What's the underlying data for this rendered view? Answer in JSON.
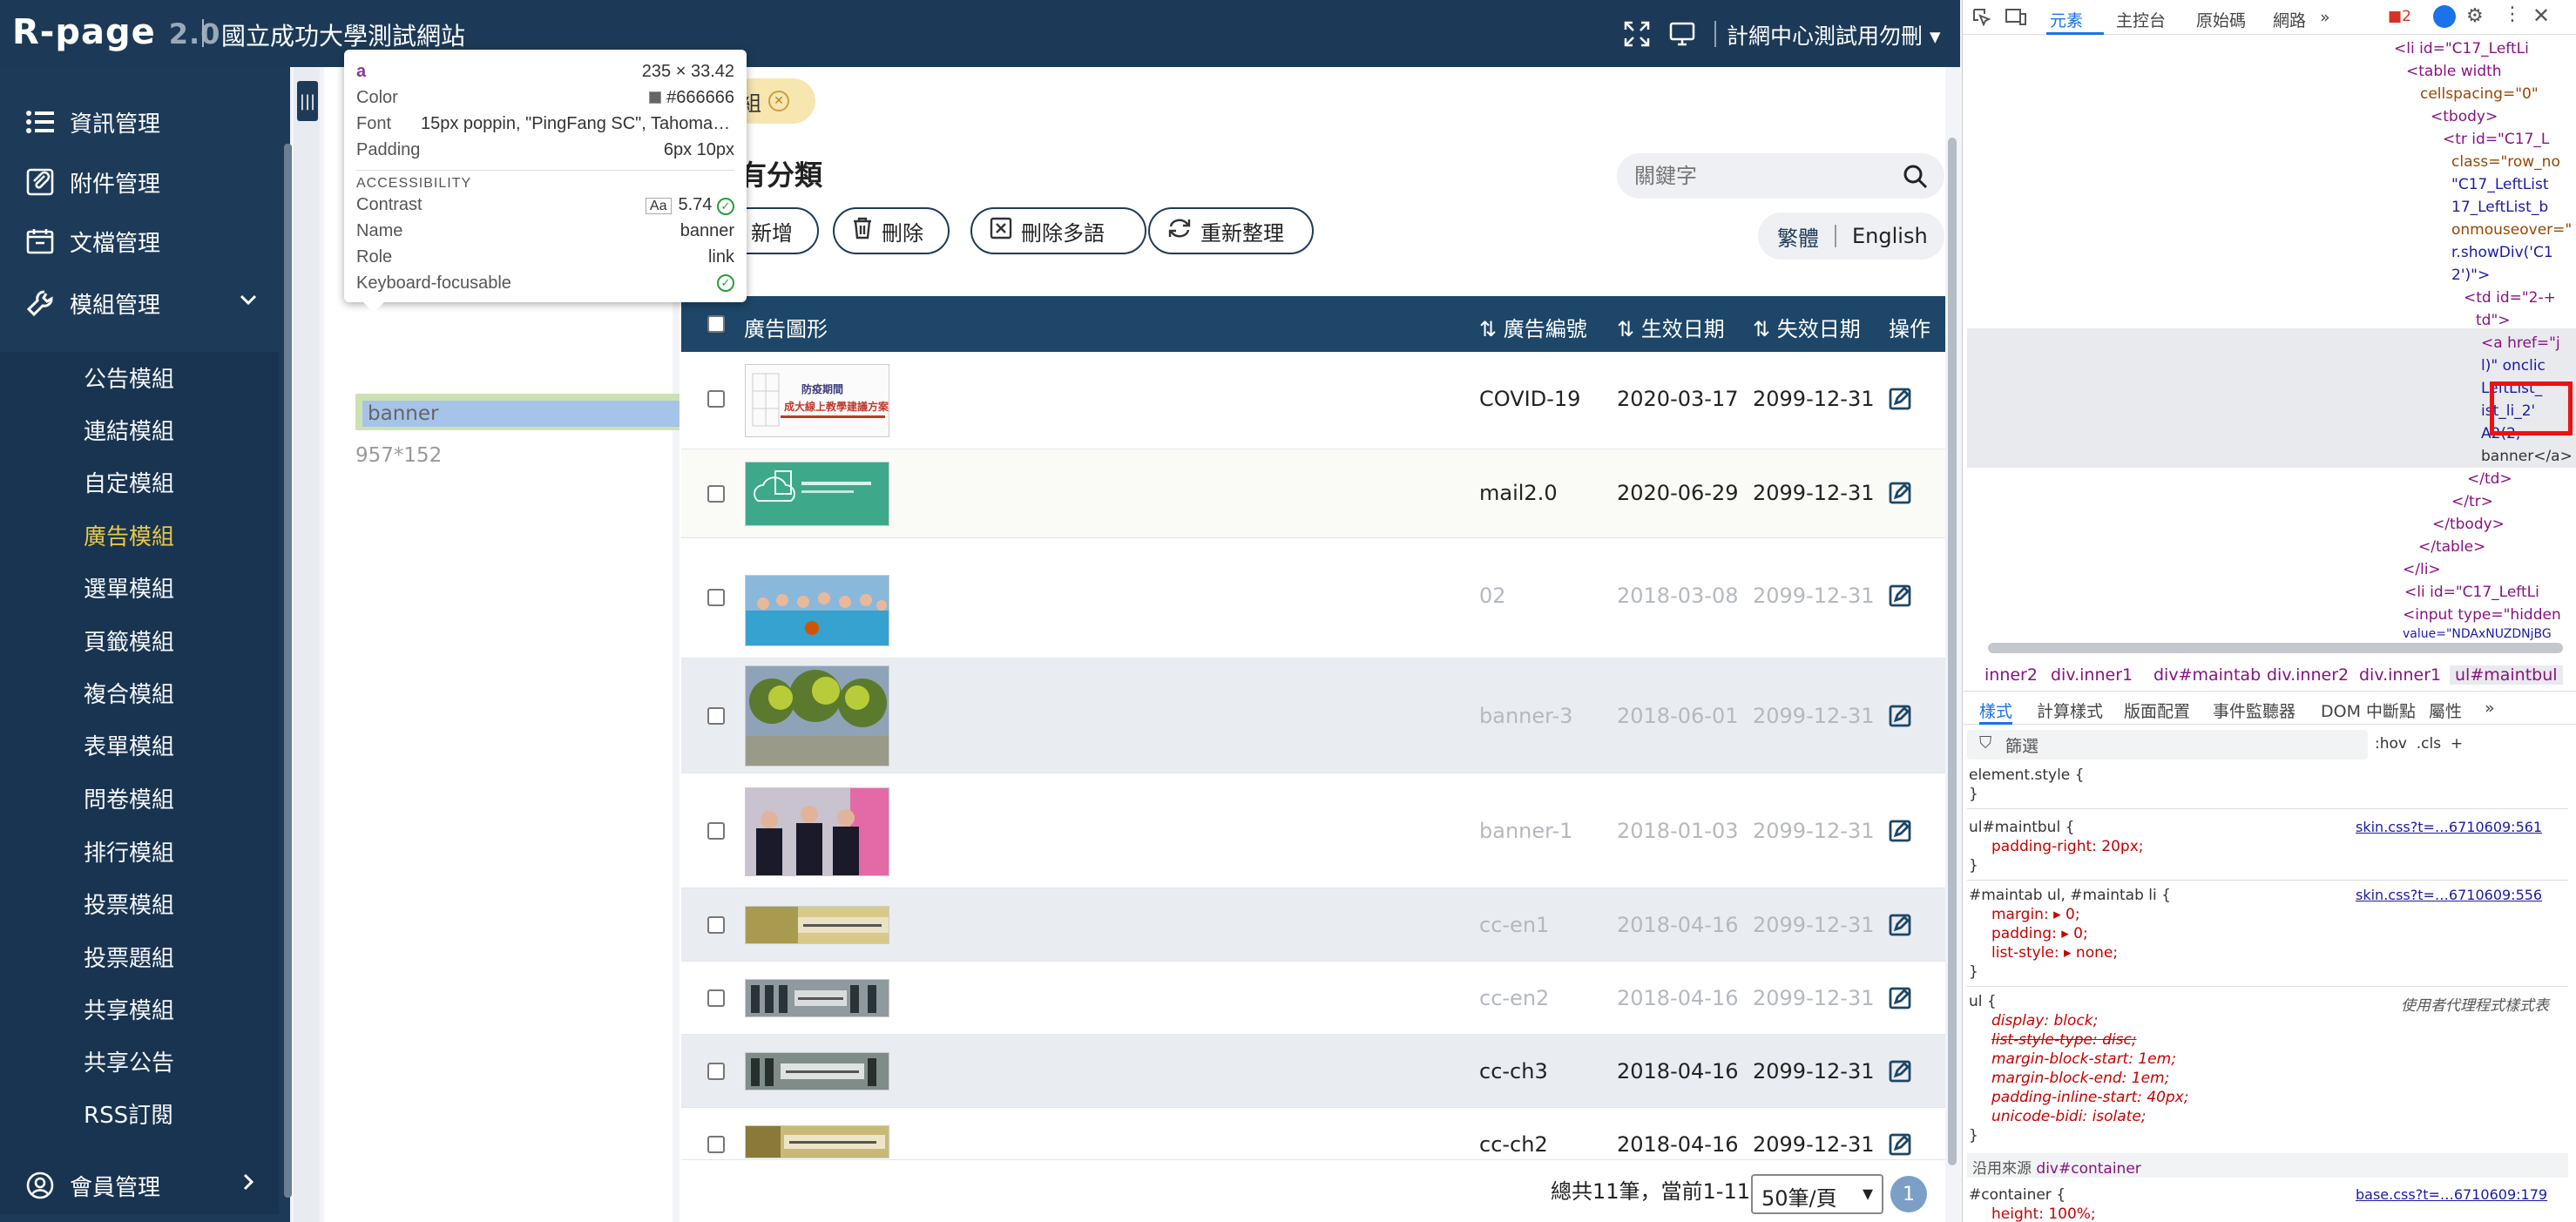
{
  "header": {
    "brand": "R-page",
    "version": "2.0",
    "site_name": "國立成功大學測試網站",
    "user": "計網中心測試用勿刪 ▾"
  },
  "sidebar": {
    "main_items": [
      {
        "label": "資訊管理",
        "icon": "list-icon"
      },
      {
        "label": "附件管理",
        "icon": "attachment-icon"
      },
      {
        "label": "文檔管理",
        "icon": "document-icon"
      },
      {
        "label": "模組管理",
        "icon": "wrench-icon"
      }
    ],
    "sub_items": [
      "公告模組",
      "連結模組",
      "自定模組",
      "廣告模組",
      "選單模組",
      "頁籤模組",
      "複合模組",
      "表單模組",
      "問卷模組",
      "排行模組",
      "投票模組",
      "投票題組",
      "共享模組",
      "共享公告",
      "RSS訂閱"
    ],
    "active_sub": "廣告模組",
    "member": "會員管理"
  },
  "tree": {
    "selected": "banner",
    "other": "957*152"
  },
  "tooltip": {
    "tag": "a",
    "size": "235 × 33.42",
    "color_label": "Color",
    "color_value": "#666666",
    "font_label": "Font",
    "font_value": "15px poppin, \"PingFang SC\", Tahoma, ...",
    "padding_label": "Padding",
    "padding_value": "6px 10px",
    "section": "ACCESSIBILITY",
    "contrast_label": "Contrast",
    "contrast_value": "5.74",
    "name_label": "Name",
    "name_value": "banner",
    "role_label": "Role",
    "role_value": "link",
    "keyboard_label": "Keyboard-focusable"
  },
  "main": {
    "chip_label": "組",
    "title": "有分類",
    "search_placeholder": "關鍵字",
    "buttons": {
      "add": "新增",
      "delete": "刪除",
      "delete_multi": "刪除多語",
      "reorder": "重新整理"
    },
    "lang": {
      "zh": "繁體",
      "en": "English"
    },
    "columns": {
      "image": "廣告圖形",
      "code": "⇅ 廣告編號",
      "start": "⇅ 生效日期",
      "end": "⇅ 失效日期",
      "ops": "操作"
    },
    "rows": [
      {
        "code": "COVID-19",
        "start": "2020-03-17",
        "end": "2099-12-31",
        "active": true,
        "thumb": "covid-banner"
      },
      {
        "code": "mail2.0",
        "start": "2020-06-29",
        "end": "2099-12-31",
        "active": true,
        "thumb": "mail-banner"
      },
      {
        "code": "02",
        "start": "2018-03-08",
        "end": "2099-12-31",
        "active": false,
        "thumb": "group-photo"
      },
      {
        "code": "banner-3",
        "start": "2018-06-01",
        "end": "2099-12-31",
        "active": false,
        "thumb": "trees-photo"
      },
      {
        "code": "banner-1",
        "start": "2018-01-03",
        "end": "2099-12-31",
        "active": false,
        "thumb": "people-photo"
      },
      {
        "code": "cc-en1",
        "start": "2018-04-16",
        "end": "2099-12-31",
        "active": false,
        "thumb": "cc-strip"
      },
      {
        "code": "cc-en2",
        "start": "2018-04-16",
        "end": "2099-12-31",
        "active": false,
        "thumb": "cc-strip"
      },
      {
        "code": "cc-ch3",
        "start": "2018-04-16",
        "end": "2099-12-31",
        "active": true,
        "thumb": "cc-strip"
      },
      {
        "code": "cc-ch2",
        "start": "2018-04-16",
        "end": "2099-12-31",
        "active": true,
        "thumb": "cc-strip"
      }
    ],
    "pager_text": "總共11筆，當前1-11",
    "per_page": "50筆/頁",
    "page": "1",
    "covid_text_1": "防疫期間",
    "covid_text_2": "成大線上教學建議方案"
  },
  "devtools": {
    "tabs": [
      "元素",
      "主控台",
      "原始碼",
      "網路",
      "»"
    ],
    "error_count": "2",
    "code_lines": [
      "<li id=\"C17_LeftLi",
      "<table width",
      "cellspacing=\"0\"",
      "<tbody>",
      "<tr id=\"C17_L",
      "class=\"row_no",
      "\"C17_LeftList",
      "17_LeftList_b",
      "onmouseover=\"",
      "r.showDiv('C1",
      "2')\">",
      "<td id=\"2-+",
      "td\">",
      "<a href=\"j",
      "l)\" onclic",
      "LeftList_",
      "ist_li_2'",
      "A2(2,",
      "banner</a>",
      "</td>",
      "</tr>",
      "</tbody>",
      "</table>",
      "</li>",
      "<li id=\"C17_LeftLi",
      "<input type=\"hidden",
      "value=\"NDAxNUZDNjBG"
    ],
    "crumbs": [
      "inner2",
      "div.inner1",
      "div#maintab",
      "div.inner2",
      "div.inner1",
      "ul#maintbul"
    ],
    "sub_tabs": [
      "樣式",
      "計算樣式",
      "版面配置",
      "事件監聽器",
      "DOM 中斷點",
      "屬性",
      "»"
    ],
    "filter_placeholder": "篩選",
    "filter_tools": ":hov  .cls  +",
    "styles": [
      {
        "selector": "element.style {",
        "src": ""
      },
      {
        "selector": "ul#maintbul {",
        "src": "skin.css?t=…6710609:561"
      },
      {
        "selector": "#maintab ul, #maintab li {",
        "src": "skin.css?t=…6710609:556"
      },
      {
        "selector": "ul {",
        "src": "使用者代理程式樣式表"
      },
      {
        "selector": "#container {",
        "src": "base.css?t=…6710609:179"
      }
    ],
    "inherit_label": "沿用來源",
    "inherit_from": "div#container",
    "decl": {
      "padding_right": "padding-right: 20px;",
      "margin": "margin: ▸ 0;",
      "padding": "padding: ▸ 0;",
      "list_style": "list-style: ▸ none;",
      "display": "display: block;",
      "list_style_type": "list-style-type: disc;",
      "mbs": "margin-block-start: 1em;",
      "mbe": "margin-block-end: 1em;",
      "pis": "padding-inline-start: 40px;",
      "ub": "unicode-bidi: isolate;",
      "height": "height: 100%;"
    },
    "close_brace": "}"
  },
  "colors": {
    "header": "#1c3a57",
    "active_menu": "#e6c84a",
    "table_head": "#1d4668",
    "tooltip_tag": "#8a3a9a"
  }
}
